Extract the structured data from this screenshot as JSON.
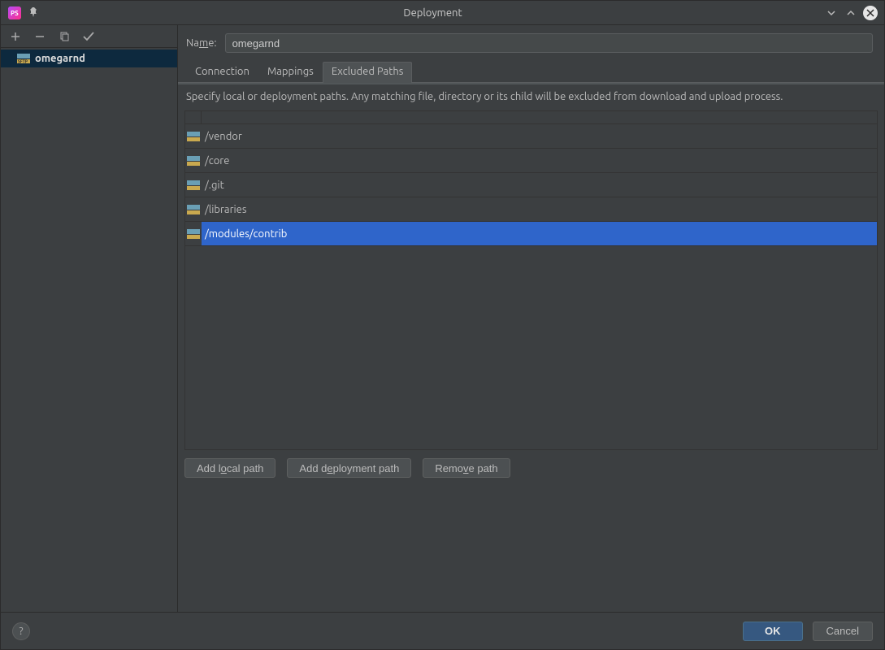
{
  "title": "Deployment",
  "sidebar": {
    "toolbar": {
      "add": "add",
      "remove": "remove",
      "copy": "copy",
      "check": "check"
    },
    "servers": [
      {
        "name": "omegarnd"
      }
    ]
  },
  "nameField": {
    "label_pre": "Na",
    "label_under": "m",
    "label_post": "e:",
    "value": "omegarnd"
  },
  "tabs": [
    {
      "id": "connection",
      "label": "Connection",
      "active": false
    },
    {
      "id": "mappings",
      "label": "Mappings",
      "active": false
    },
    {
      "id": "excluded",
      "label": "Excluded Paths",
      "active": true
    }
  ],
  "description": "Specify local or deployment paths. Any matching file, directory or its child will be excluded from download and upload process.",
  "paths": [
    {
      "path": "/vendor",
      "selected": false
    },
    {
      "path": "/core",
      "selected": false
    },
    {
      "path": "/.git",
      "selected": false
    },
    {
      "path": "/libraries",
      "selected": false
    },
    {
      "path": "/modules/contrib",
      "selected": true
    }
  ],
  "buttons": {
    "addLocal_pre": "Add l",
    "addLocal_u": "o",
    "addLocal_post": "cal path",
    "addDeploy_pre": "Add d",
    "addDeploy_u": "e",
    "addDeploy_post": "ployment path",
    "remove_pre": "Remo",
    "remove_u": "v",
    "remove_post": "e path",
    "ok": "OK",
    "cancel": "Cancel",
    "help": "?"
  }
}
